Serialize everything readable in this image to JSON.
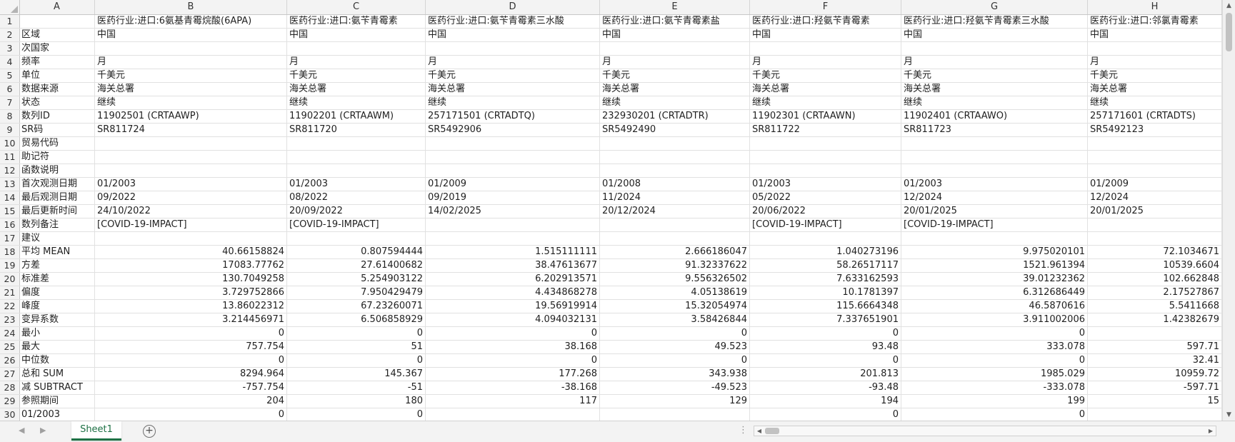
{
  "columns": [
    "A",
    "B",
    "C",
    "D",
    "E",
    "F",
    "G",
    "H"
  ],
  "rows": [
    [
      "1",
      "",
      "医药行业:进口:6氨基青霉烷酸(6APA)",
      "医药行业:进口:氨苄青霉素",
      "医药行业:进口:氨苄青霉素三水酸",
      "医药行业:进口:氨苄青霉素盐",
      "医药行业:进口:羟氨苄青霉素",
      "医药行业:进口:羟氨苄青霉素三水酸",
      "医药行业:进口:邻氯青霉素"
    ],
    [
      "2",
      "区域",
      "中国",
      "中国",
      "中国",
      "中国",
      "中国",
      "中国",
      "中国"
    ],
    [
      "3",
      "次国家",
      "",
      "",
      "",
      "",
      "",
      "",
      ""
    ],
    [
      "4",
      "频率",
      "月",
      "月",
      "月",
      "月",
      "月",
      "月",
      "月"
    ],
    [
      "5",
      "单位",
      "千美元",
      "千美元",
      "千美元",
      "千美元",
      "千美元",
      "千美元",
      "千美元"
    ],
    [
      "6",
      "数据来源",
      "海关总署",
      "海关总署",
      "海关总署",
      "海关总署",
      "海关总署",
      "海关总署",
      "海关总署"
    ],
    [
      "7",
      "状态",
      "继续",
      "继续",
      "继续",
      "继续",
      "继续",
      "继续",
      "继续"
    ],
    [
      "8",
      "数列ID",
      "11902501 (CRTAAWP)",
      "11902201 (CRTAAWM)",
      "257171501 (CRTADTQ)",
      "232930201 (CRTADTR)",
      "11902301 (CRTAAWN)",
      "11902401 (CRTAAWO)",
      "257171601 (CRTADTS)"
    ],
    [
      "9",
      "SR码",
      "SR811724",
      "SR811720",
      "SR5492906",
      "SR5492490",
      "SR811722",
      "SR811723",
      "SR5492123"
    ],
    [
      "10",
      "贸易代码",
      "",
      "",
      "",
      "",
      "",
      "",
      ""
    ],
    [
      "11",
      "助记符",
      "",
      "",
      "",
      "",
      "",
      "",
      ""
    ],
    [
      "12",
      "函数说明",
      "",
      "",
      "",
      "",
      "",
      "",
      ""
    ],
    [
      "13",
      "首次观测日期",
      "01/2003",
      "01/2003",
      "01/2009",
      "01/2008",
      "01/2003",
      "01/2003",
      "01/2009"
    ],
    [
      "14",
      "最后观测日期",
      "09/2022",
      "08/2022",
      "09/2019",
      "11/2024",
      "05/2022",
      "12/2024",
      "12/2024"
    ],
    [
      "15",
      "最后更新时间",
      "24/10/2022",
      "20/09/2022",
      "14/02/2025",
      "20/12/2024",
      "20/06/2022",
      "20/01/2025",
      "20/01/2025"
    ],
    [
      "16",
      "数列备注",
      "[COVID-19-IMPACT]",
      "[COVID-19-IMPACT]",
      "",
      "",
      "[COVID-19-IMPACT]",
      "[COVID-19-IMPACT]",
      ""
    ],
    [
      "17",
      "建议",
      "",
      "",
      "",
      "",
      "",
      "",
      ""
    ],
    [
      "18",
      "平均 MEAN",
      "40.66158824",
      "0.807594444",
      "1.515111111",
      "2.666186047",
      "1.040273196",
      "9.975020101",
      "72.1034671"
    ],
    [
      "19",
      "方差",
      "17083.77762",
      "27.61400682",
      "38.47613677",
      "91.32337622",
      "58.26517117",
      "1521.961394",
      "10539.6604"
    ],
    [
      "20",
      "标准差",
      "130.7049258",
      "5.254903122",
      "6.202913571",
      "9.556326502",
      "7.633162593",
      "39.01232362",
      "102.662848"
    ],
    [
      "21",
      "偏度",
      "3.729752866",
      "7.950429479",
      "4.434868278",
      "4.05138619",
      "10.1781397",
      "6.312686449",
      "2.17527867"
    ],
    [
      "22",
      "峰度",
      "13.86022312",
      "67.23260071",
      "19.56919914",
      "15.32054974",
      "115.6664348",
      "46.5870616",
      "5.5411668"
    ],
    [
      "23",
      "变异系数",
      "3.214456971",
      "6.506858929",
      "4.094032131",
      "3.58426844",
      "7.337651901",
      "3.911002006",
      "1.42382679"
    ],
    [
      "24",
      "最小",
      "0",
      "0",
      "0",
      "0",
      "0",
      "0",
      ""
    ],
    [
      "25",
      "最大",
      "757.754",
      "51",
      "38.168",
      "49.523",
      "93.48",
      "333.078",
      "597.71"
    ],
    [
      "26",
      "中位数",
      "0",
      "0",
      "0",
      "0",
      "0",
      "0",
      "32.41"
    ],
    [
      "27",
      "总和 SUM",
      "8294.964",
      "145.367",
      "177.268",
      "343.938",
      "201.813",
      "1985.029",
      "10959.72"
    ],
    [
      "28",
      "减 SUBTRACT",
      "-757.754",
      "-51",
      "-38.168",
      "-49.523",
      "-93.48",
      "-333.078",
      "-597.71"
    ],
    [
      "29",
      "参照期间",
      "204",
      "180",
      "117",
      "129",
      "194",
      "199",
      "15"
    ],
    [
      "30",
      "01/2003",
      "0",
      "0",
      "",
      "",
      "0",
      "0",
      ""
    ]
  ],
  "sheet_tab": "Sheet1",
  "add_sheet_symbol": "+",
  "bottom_dots": "⋮",
  "scroll_up": "▲",
  "scroll_down": "▼",
  "scroll_left": "◀",
  "scroll_right": "▶",
  "nav_prev": "◀",
  "nav_next": "▶"
}
